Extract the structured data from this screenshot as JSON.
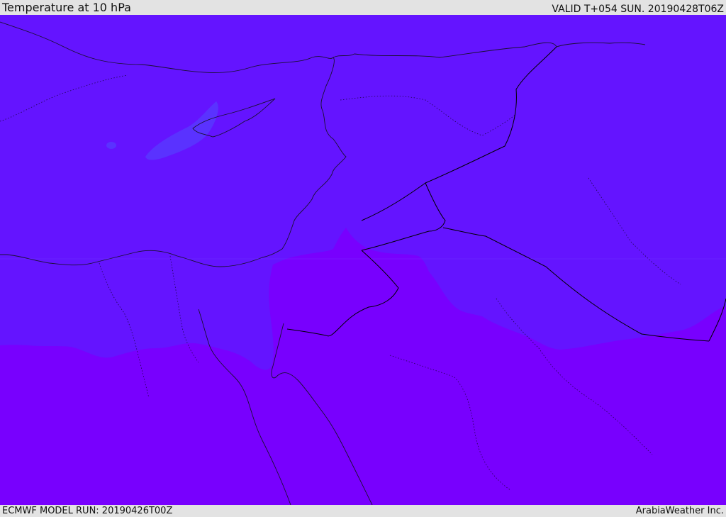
{
  "header": {
    "title": "Temperature at 10 hPa",
    "valid": "VALID T+054 SUN. 20190428T06Z"
  },
  "footer": {
    "model_run": "ECMWF MODEL RUN: 20190426T00Z",
    "credit": "ArabiaWeather Inc."
  },
  "map": {
    "colors": {
      "north_band": "#6414ff",
      "south_band": "#7800fe",
      "warm_patch": "#5a32ff",
      "coastline": "#1a1030",
      "border": "#000000"
    }
  }
}
